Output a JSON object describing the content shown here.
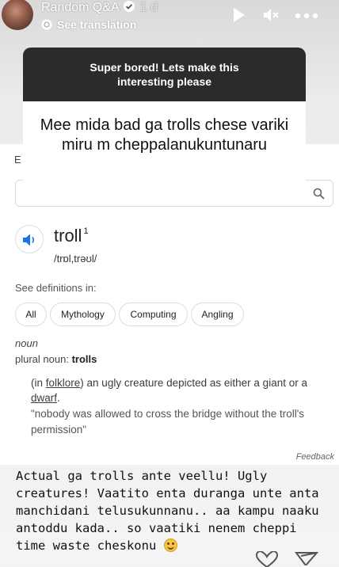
{
  "header": {
    "author": "Random Q&A",
    "time_ago": "1 d",
    "see_translation": "See translation"
  },
  "question": {
    "prompt": "Super bored! Lets make this interesting please",
    "response": "Mee mida bad ga trolls chese variki miru m cheppalanukuntunaru"
  },
  "google": {
    "fragment": "E",
    "search_value": "",
    "word": "troll",
    "superscript": "1",
    "pronunciation": "/trɒl,trəʊl/",
    "see_definitions": "See definitions in:",
    "chips": [
      "All",
      "Mythology",
      "Computing",
      "Angling"
    ],
    "part_of_speech": "noun",
    "plural_label": "plural noun:",
    "plural_value": "trolls",
    "definition": {
      "open": "(in ",
      "link1": "folklore",
      "mid": ") an ugly creature depicted as either a giant or a ",
      "link2": "dwarf",
      "end": "."
    },
    "example": "\"nobody was allowed to cross the bridge without the troll's permission\"",
    "feedback": "Feedback"
  },
  "answer": {
    "text": "Actual ga trolls ante veellu! Ugly creatures! Vaatito enta duranga unte anta manchidani telusukunnanu.. aa kampu naaku antoddu kada.. so vaatiki nenem cheppi time waste cheskonu"
  },
  "icons": {
    "play": "play-icon",
    "mute": "speaker-muted-icon",
    "more": "more-icon",
    "like": "heart-icon",
    "share": "send-icon"
  }
}
